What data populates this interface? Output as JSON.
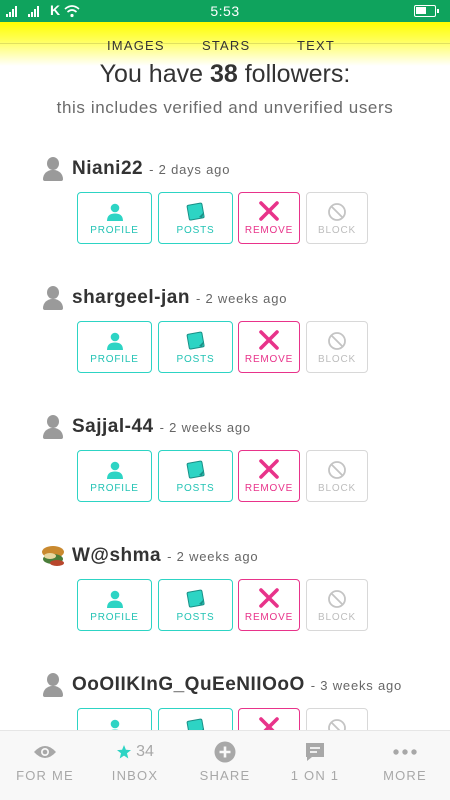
{
  "status_bar": {
    "time": "5:53",
    "carrier_glyph": "K"
  },
  "top_tabs": [
    "IMAGES",
    "STARS",
    "TEXT"
  ],
  "headline": {
    "prefix": "You have ",
    "count": "38",
    "suffix": " followers:"
  },
  "subheadline": "this includes verified and unverified users",
  "action_labels": {
    "profile": "PROFILE",
    "posts": "POSTS",
    "remove": "REMOVE",
    "block": "BLOCK"
  },
  "followers": [
    {
      "username": "Niani22",
      "time": "- 2 days ago"
    },
    {
      "username": "shargeel-jan",
      "time": "- 2 weeks ago"
    },
    {
      "username": "Sajjal-44",
      "time": "- 2 weeks ago"
    },
    {
      "username": "W@shma",
      "time": "- 2 weeks ago"
    },
    {
      "username": "OoOIIKInG_QuEeNIIOoO",
      "time": "- 3 weeks ago"
    }
  ],
  "bottom_nav": [
    {
      "label": "FOR ME",
      "icon": "eye-icon"
    },
    {
      "label": "INBOX",
      "icon": "star-icon",
      "count": "34"
    },
    {
      "label": "SHARE",
      "icon": "plus-circle-icon"
    },
    {
      "label": "1 ON 1",
      "icon": "chat-icon"
    },
    {
      "label": "MORE",
      "icon": "more-dots-icon"
    }
  ],
  "colors": {
    "status_bar": "#0fa35d",
    "accent_teal": "#2dd4c4",
    "remove_pink": "#e8338a",
    "header_yellow": "#ffff00"
  }
}
